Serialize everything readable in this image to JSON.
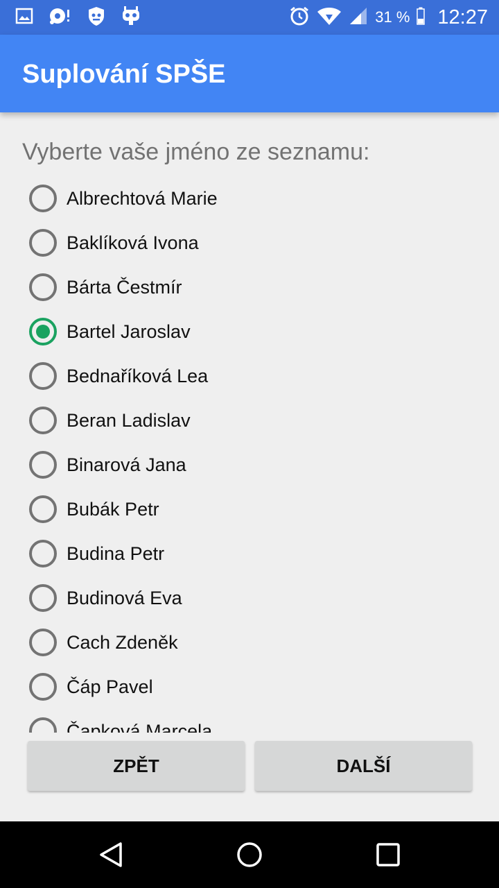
{
  "status_bar": {
    "battery_percent": "31 %",
    "time": "12:27",
    "icons": [
      "image-icon",
      "android-debug-icon",
      "shield-icon",
      "cyanogen-icon",
      "alarm-icon",
      "wifi-icon",
      "signal-icon",
      "battery-icon"
    ]
  },
  "app_bar": {
    "title": "Suplování SPŠE"
  },
  "prompt": "Vyberte vaše jméno ze seznamu:",
  "names": [
    {
      "label": "Albrechtová Marie",
      "checked": false
    },
    {
      "label": "Baklíková Ivona",
      "checked": false
    },
    {
      "label": "Bárta Čestmír",
      "checked": false
    },
    {
      "label": "Bartel Jaroslav",
      "checked": true
    },
    {
      "label": "Bednaříková Lea",
      "checked": false
    },
    {
      "label": "Beran Ladislav",
      "checked": false
    },
    {
      "label": "Binarová Jana",
      "checked": false
    },
    {
      "label": "Bubák Petr",
      "checked": false
    },
    {
      "label": "Budina Petr",
      "checked": false
    },
    {
      "label": "Budinová Eva",
      "checked": false
    },
    {
      "label": "Cach Zdeněk",
      "checked": false
    },
    {
      "label": "Čáp Pavel",
      "checked": false
    },
    {
      "label": "Čapková Marcela",
      "checked": false
    }
  ],
  "buttons": {
    "back": "ZPĚT",
    "next": "DALŠÍ"
  },
  "colors": {
    "app_bar": "#4285f4",
    "status_bar": "#3a6fd8",
    "radio_checked": "#1aa260"
  }
}
